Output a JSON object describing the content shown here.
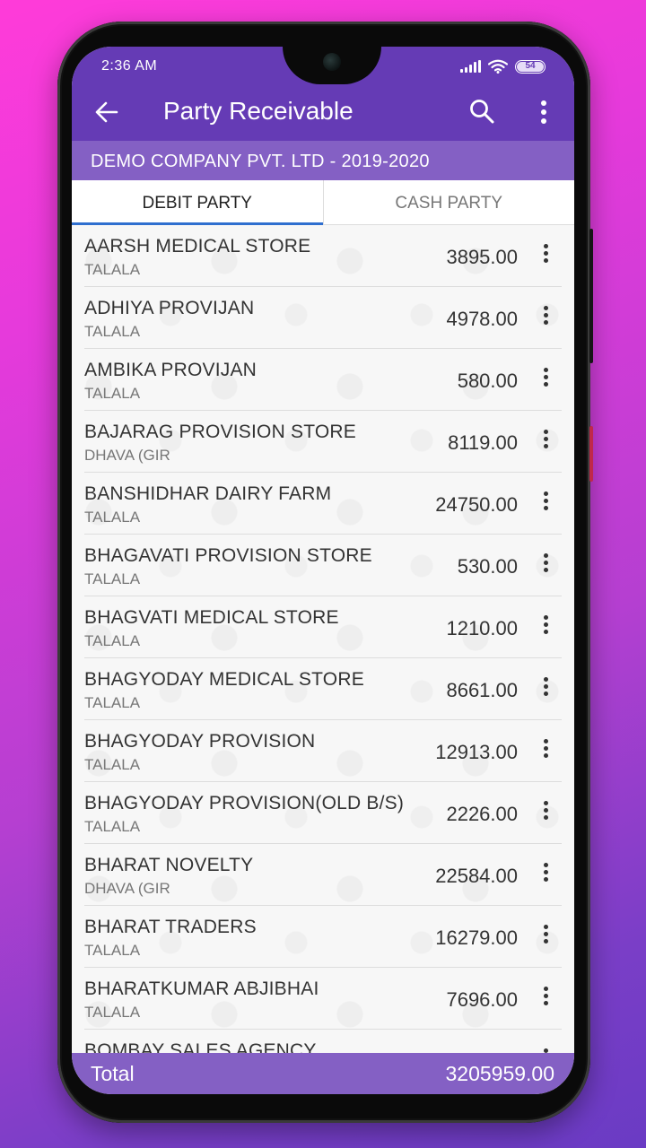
{
  "status_bar": {
    "time": "2:36 AM",
    "battery": "54"
  },
  "app_bar": {
    "title": "Party Receivable",
    "back_icon": "arrow-left-icon",
    "search_icon": "search-icon",
    "more_icon": "more-vert-icon"
  },
  "company": "DEMO COMPANY PVT. LTD - 2019-2020",
  "tabs": [
    {
      "label": "DEBIT PARTY",
      "active": true
    },
    {
      "label": "CASH PARTY",
      "active": false
    }
  ],
  "parties": [
    {
      "name": "AARSH MEDICAL STORE",
      "city": "TALALA",
      "amount": "3895.00"
    },
    {
      "name": "ADHIYA PROVIJAN",
      "city": "TALALA",
      "amount": "4978.00"
    },
    {
      "name": "AMBIKA PROVIJAN",
      "city": "TALALA",
      "amount": "580.00"
    },
    {
      "name": "BAJARAG PROVISION STORE",
      "city": "DHAVA (GIR",
      "amount": "8119.00"
    },
    {
      "name": "BANSHIDHAR DAIRY FARM",
      "city": "TALALA",
      "amount": "24750.00"
    },
    {
      "name": "BHAGAVATI PROVISION STORE",
      "city": "TALALA",
      "amount": "530.00"
    },
    {
      "name": "BHAGVATI MEDICAL STORE",
      "city": "TALALA",
      "amount": "1210.00"
    },
    {
      "name": "BHAGYODAY MEDICAL STORE",
      "city": "TALALA",
      "amount": "8661.00"
    },
    {
      "name": "BHAGYODAY PROVISION",
      "city": "TALALA",
      "amount": "12913.00"
    },
    {
      "name": "BHAGYODAY PROVISION(OLD B/S)",
      "city": "TALALA",
      "amount": "2226.00"
    },
    {
      "name": "BHARAT NOVELTY",
      "city": "DHAVA (GIR",
      "amount": "22584.00"
    },
    {
      "name": "BHARAT TRADERS",
      "city": "TALALA",
      "amount": "16279.00"
    },
    {
      "name": "BHARATKUMAR ABJIBHAI",
      "city": "TALALA",
      "amount": "7696.00"
    },
    {
      "name": "BOMBAY SALES AGENCY",
      "city": "",
      "amount": ""
    }
  ],
  "total": {
    "label": "Total",
    "value": "3205959.00"
  },
  "colors": {
    "app_bar": "#653bb5",
    "company_bar": "#8460c4",
    "tab_indicator": "#2f6fcf"
  }
}
